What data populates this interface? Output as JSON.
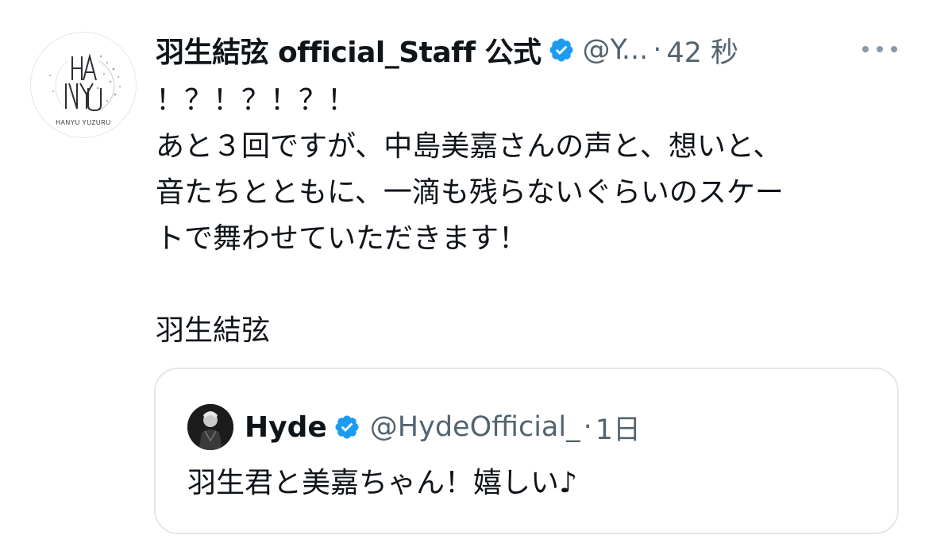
{
  "tweet": {
    "author": {
      "display_name": "羽生結弦 official_Staff 公式",
      "handle": "@Y...",
      "avatar_logo_text": "HANYU YUZURU",
      "avatar_monogram": "HANYU"
    },
    "separator": "·",
    "time": "42 秒",
    "text": "！？！？！？！\nあと３回ですが、中島美嘉さんの声と、想いと、\n音たちとともに、一滴も残らないぐらいのスケー\nトで舞わせていただきます！\n\n羽生結弦"
  },
  "quoted_tweet": {
    "author": {
      "display_name": "Hyde",
      "handle": "@HydeOfficial_"
    },
    "separator": "·",
    "time": "1日",
    "text": "羽生君と美嘉ちゃん！嬉しい♪"
  },
  "icons": {
    "verified": "verified-badge-icon",
    "more": "more-options-icon"
  },
  "colors": {
    "verified_blue": "#1d9bf0",
    "text_primary": "#0f1419",
    "text_secondary": "#536471",
    "border": "#e1e8ed"
  }
}
